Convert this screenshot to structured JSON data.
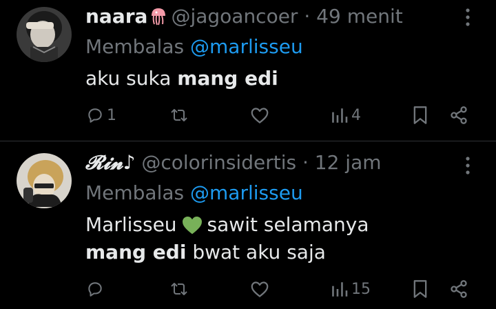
{
  "tweets": [
    {
      "name": "naara",
      "name_emoji": "jellyfish-icon",
      "handle": "@jagoancoer",
      "dot": "·",
      "time": "49 menit",
      "reply_prefix": "Membalas",
      "reply_to": "@marlisseu",
      "text_plain": "aku suka ",
      "text_bold": "mang edi",
      "counts": {
        "replies": "1",
        "views": "4"
      }
    },
    {
      "name": "𝓡𝓲𝓷♪",
      "handle": "@colorinsidertis",
      "dot": "·",
      "time": "12 jam",
      "reply_prefix": "Membalas",
      "reply_to": "@marlisseu",
      "line1_a": "Marlisseu",
      "line1_emoji": "green-heart-icon",
      "line1_b": "sawit selamanya",
      "line2_bold": "mang edi",
      "line2_plain": " bwat aku saja",
      "counts": {
        "replies": "",
        "views": "15"
      }
    }
  ],
  "colors": {
    "bg": "#000000",
    "text": "#e7e9ea",
    "muted": "#71767b",
    "link": "#1d9bf0",
    "divider": "#2f3336"
  }
}
